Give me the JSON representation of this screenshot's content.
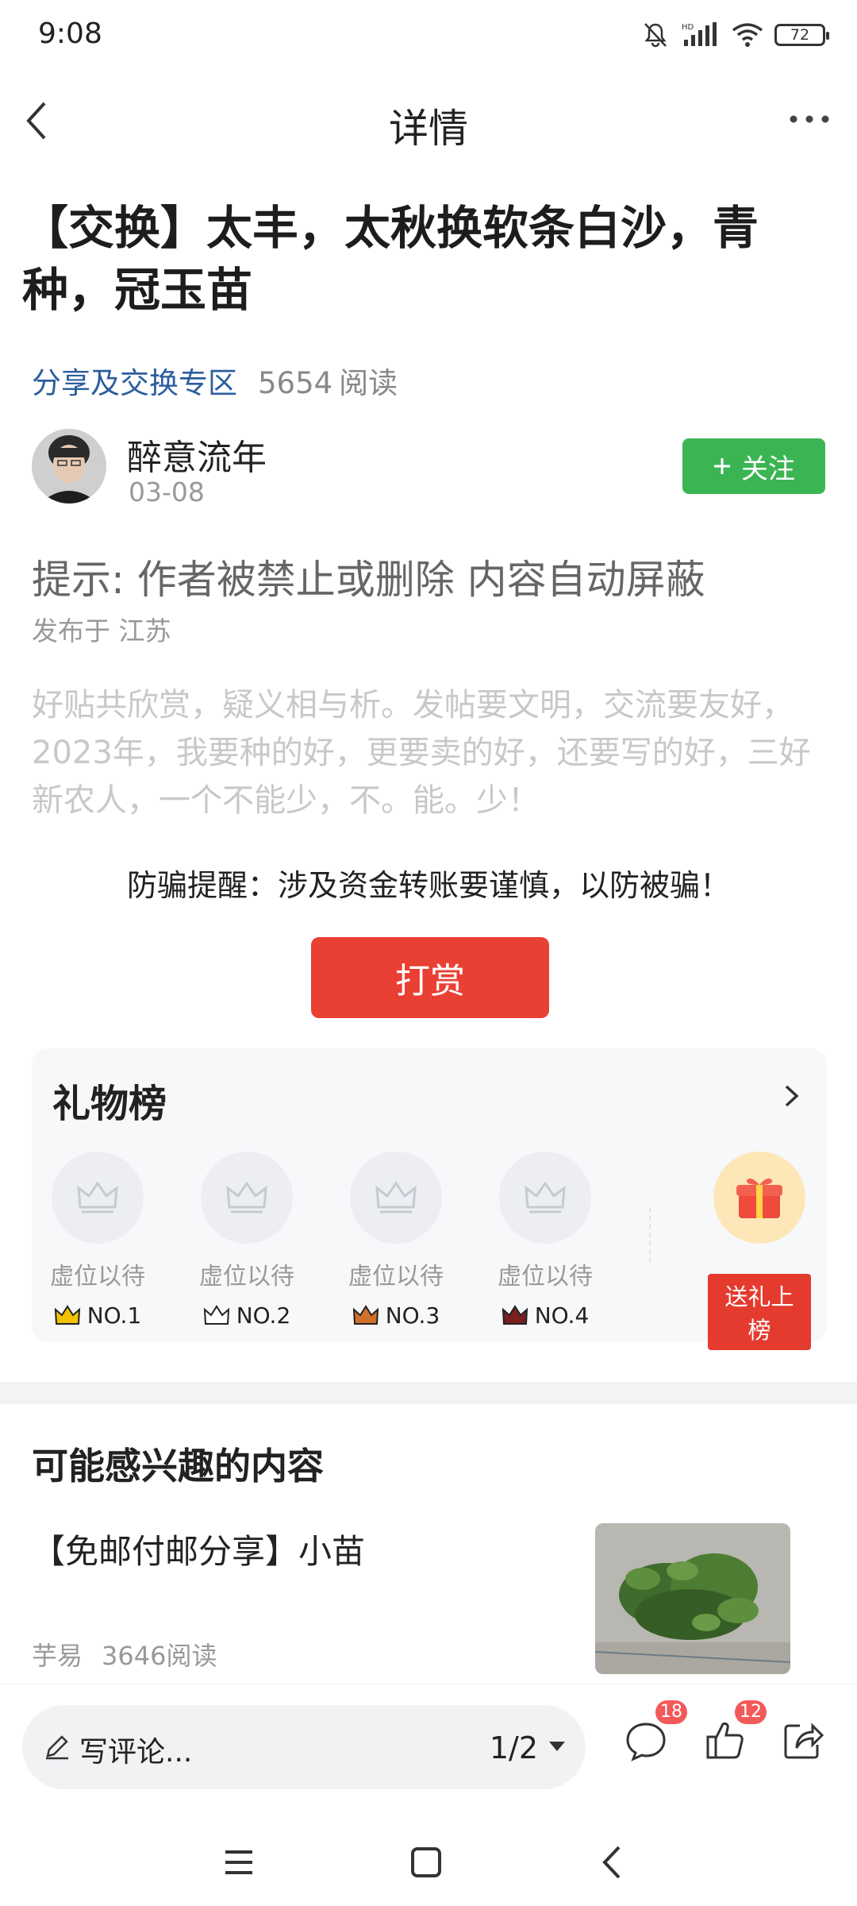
{
  "status": {
    "time": "9:08",
    "battery": "72",
    "hd_label": "HD"
  },
  "nav": {
    "title": "详情"
  },
  "post": {
    "title": "【交换】太丰，太秋换软条白沙，青种，冠玉苗",
    "category": "分享及交换专区",
    "read_count": "5654",
    "read_label": "阅读",
    "author_name": "醉意流年",
    "date": "03-08",
    "follow_label": "关注",
    "notice": "提示: 作者被禁止或删除 内容自动屏蔽",
    "location": "发布于 江苏",
    "signature": "好贴共欣赏，疑义相与析。发帖要文明，交流要友好，2023年，我要种的好，更要卖的好，还要写的好，三好新农人，一个不能少，不。能。少！",
    "fraud_warning": "防骗提醒：涉及资金转账要谨慎，以防被骗！",
    "reward_label": "打赏"
  },
  "gift_board": {
    "title": "礼物榜",
    "slots": [
      {
        "label": "虚位以待",
        "rank": "NO.1",
        "crown_color": "#f2c200"
      },
      {
        "label": "虚位以待",
        "rank": "NO.2",
        "crown_color": "#555555"
      },
      {
        "label": "虚位以待",
        "rank": "NO.3",
        "crown_color": "#d0702a"
      },
      {
        "label": "虚位以待",
        "rank": "NO.4",
        "crown_color": "#7a1f1f"
      }
    ],
    "send_label": "送礼上榜"
  },
  "recommend": {
    "title": "可能感兴趣的内容",
    "items": [
      {
        "title": "【免邮付邮分享】小苗",
        "author": "芋易",
        "reads": "3646阅读"
      }
    ]
  },
  "bottom_bar": {
    "comment_placeholder": "写评论...",
    "page_indicator": "1/2",
    "comment_count": "18",
    "like_count": "12"
  },
  "colors": {
    "accent_green": "#3bb553",
    "reward_red": "#e94034",
    "link_blue": "#2b5e9e"
  }
}
